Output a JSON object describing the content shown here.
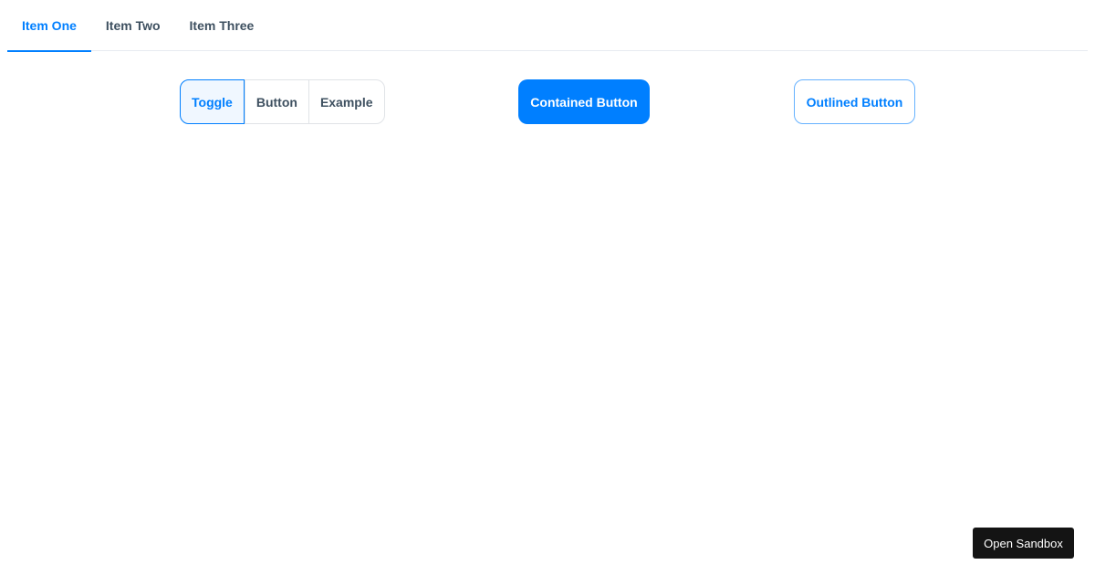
{
  "tabs": {
    "items": [
      {
        "label": "Item One",
        "active": true
      },
      {
        "label": "Item Two",
        "active": false
      },
      {
        "label": "Item Three",
        "active": false
      }
    ]
  },
  "toggle_group": {
    "buttons": [
      {
        "label": "Toggle",
        "selected": true
      },
      {
        "label": "Button",
        "selected": false
      },
      {
        "label": "Example",
        "selected": false
      }
    ]
  },
  "contained_button": {
    "label": "Contained Button"
  },
  "outlined_button": {
    "label": "Outlined Button"
  },
  "sandbox_button": {
    "label": "Open Sandbox"
  },
  "colors": {
    "primary": "#007fff",
    "text": "#3e5060",
    "selected_bg": "#f0f7ff",
    "sandbox_bg": "#141414"
  }
}
